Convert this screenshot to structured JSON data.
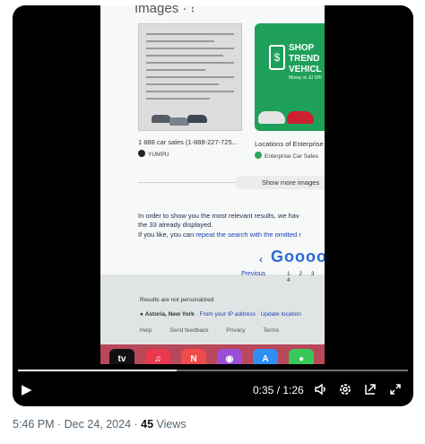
{
  "video": {
    "screen": {
      "partial_heading": "Images · ⁝",
      "image_results": [
        {
          "caption": "1 888 car sales (1-888-227-725...",
          "source": "YUMPU"
        },
        {
          "caption": "Locations of Enterprise",
          "source": "Enterprise Car Sales"
        }
      ],
      "ad_text": "SHOP\nTREND\nVEHICL",
      "ad_subtext": "Mossy st. El SHI",
      "show_more": "Show more images",
      "info_line1": "In order to show you the most relevant results, we hav",
      "info_line2": "the 33 already displayed.",
      "info_line3_prefix": "If you like, you can ",
      "info_line3_link": "repeat the search with the omitted r",
      "google_logo": "Gooooo",
      "previous": "Previous",
      "pages": "1 2 3 4",
      "not_personalized": "Results are not personalized",
      "location": "Astoria, New York",
      "ip_link": "From your IP address",
      "update_location": "Update location",
      "footer_links": [
        "Help",
        "Send feedback",
        "Privacy",
        "Terms"
      ],
      "dock_icons": [
        {
          "icon": "apple-tv-icon",
          "label": "tv",
          "color": "#111111"
        },
        {
          "icon": "music-icon",
          "label": "♫",
          "color": "#e8394f"
        },
        {
          "icon": "news-icon",
          "label": "N",
          "color": "#f04a4a"
        },
        {
          "icon": "podcasts-icon",
          "label": "◉",
          "color": "#9b4fd6"
        },
        {
          "icon": "app-store-icon",
          "label": "A",
          "color": "#2f8ef3"
        },
        {
          "icon": "messages-icon",
          "label": "●",
          "color": "#37c85a"
        }
      ]
    },
    "player": {
      "current_time": "0:35",
      "duration": "1:26",
      "time_display": "0:35 / 1:26",
      "progress_fraction": 0.407
    }
  },
  "meta": {
    "timestamp": "5:46 PM · Dec 24, 2024 · ",
    "views_count": "45",
    "views_label": " Views"
  }
}
